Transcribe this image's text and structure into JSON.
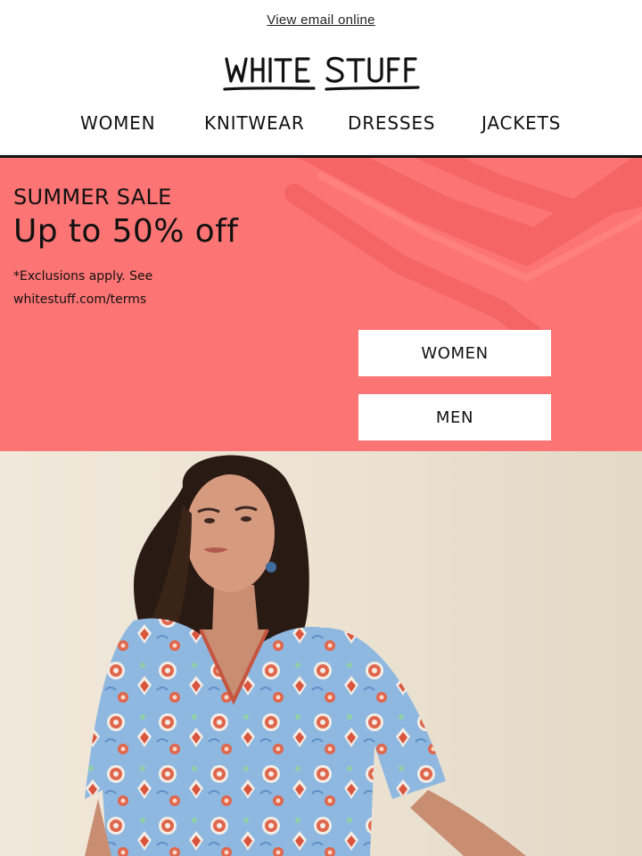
{
  "header": {
    "view_online": "View email online",
    "brand": "WHITE STUFF",
    "nav": [
      "WOMEN",
      "KNITWEAR",
      "DRESSES",
      "JACKETS"
    ]
  },
  "hero": {
    "label": "SUMMER SALE",
    "headline": "Up to 50% off",
    "note": "*Exclusions apply. See whitestuff.com/terms",
    "buttons": [
      "WOMEN",
      "MEN"
    ],
    "background_color": "#fd7474"
  },
  "photo": {
    "subject": "model-in-blue-floral-dress"
  },
  "colors": {
    "accent": "#fd7474",
    "text": "#111111",
    "dress": "#8fb8e0"
  }
}
